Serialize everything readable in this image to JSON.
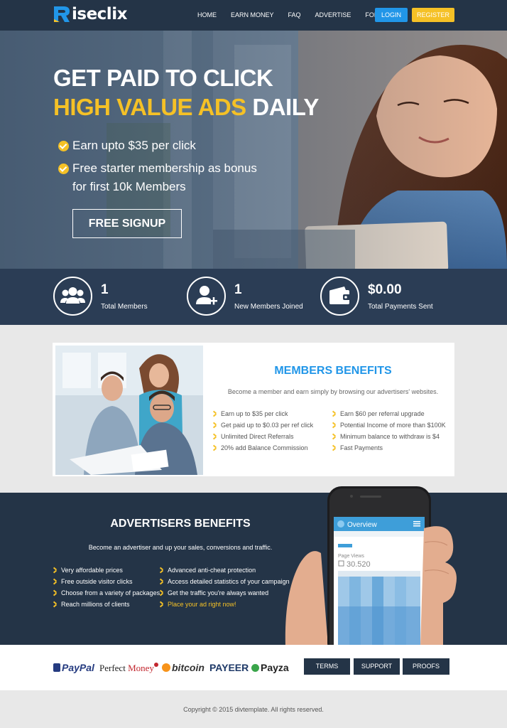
{
  "brand": {
    "logo_r": "R",
    "logo_text": "iseclix"
  },
  "nav": {
    "links": [
      "HOME",
      "EARN MONEY",
      "FAQ",
      "ADVERTISE",
      "FORUM"
    ],
    "login": "LOGIN",
    "register": "REGISTER"
  },
  "hero": {
    "line1": "GET PAID TO CLICK",
    "line2_highlight": "HIGH VALUE ADS",
    "line2_rest": " DAILY",
    "bullets": [
      "Earn upto $35 per click",
      "Free starter membership as bonus",
      "for first 10k Members"
    ],
    "cta": "FREE SIGNUP"
  },
  "stats": [
    {
      "value": "1",
      "label": "Total Members",
      "icon": "group-icon"
    },
    {
      "value": "1",
      "label": "New Members Joined",
      "icon": "add-user-icon"
    },
    {
      "value": "$0.00",
      "label": "Total Payments Sent",
      "icon": "wallet-icon"
    }
  ],
  "members": {
    "title": "MEMBERS BENEFITS",
    "subtitle": "Become a member and earn simply by browsing our advertisers' websites.",
    "left": [
      "Earn up to $35 per click",
      "Get paid up to $0.03 per ref click",
      "Unlimited Direct Referrals",
      "20% add Balance Commission"
    ],
    "right": [
      "Earn $60 per referral upgrade",
      "Potential Income of more than $100K",
      "Minimum balance to withdraw is $4",
      "Fast Payments"
    ]
  },
  "advertisers": {
    "title": "ADVERTISERS BENEFITS",
    "subtitle": "Become an advertiser and up your sales, conversions and traffic.",
    "left": [
      "Very affordable prices",
      "Free outside visitor clicks",
      "Choose from a variety of packages",
      "Reach millions of clients"
    ],
    "right": [
      "Advanced anti-cheat protection",
      "Access detailed statistics of your campaign",
      "Get the traffic you're always wanted",
      "Place your ad right now!"
    ]
  },
  "phone": {
    "overview": "Overview",
    "page_views_label": "Page Views",
    "page_views_value": "30.520"
  },
  "payments": {
    "paypal": "PayPal",
    "perfect": "Perfect",
    "money": "Money",
    "bitcoin": "bitcoin",
    "payeer": "PAYEER",
    "payza": "Payza"
  },
  "footer": {
    "buttons": [
      "TERMS",
      "SUPPORT",
      "PROOFS"
    ],
    "copyright": "Copyright © 2015 divtemplate. All rights reserved."
  },
  "colors": {
    "navy": "#243447",
    "accent_blue": "#2196e8",
    "accent_yellow": "#f5c126"
  }
}
